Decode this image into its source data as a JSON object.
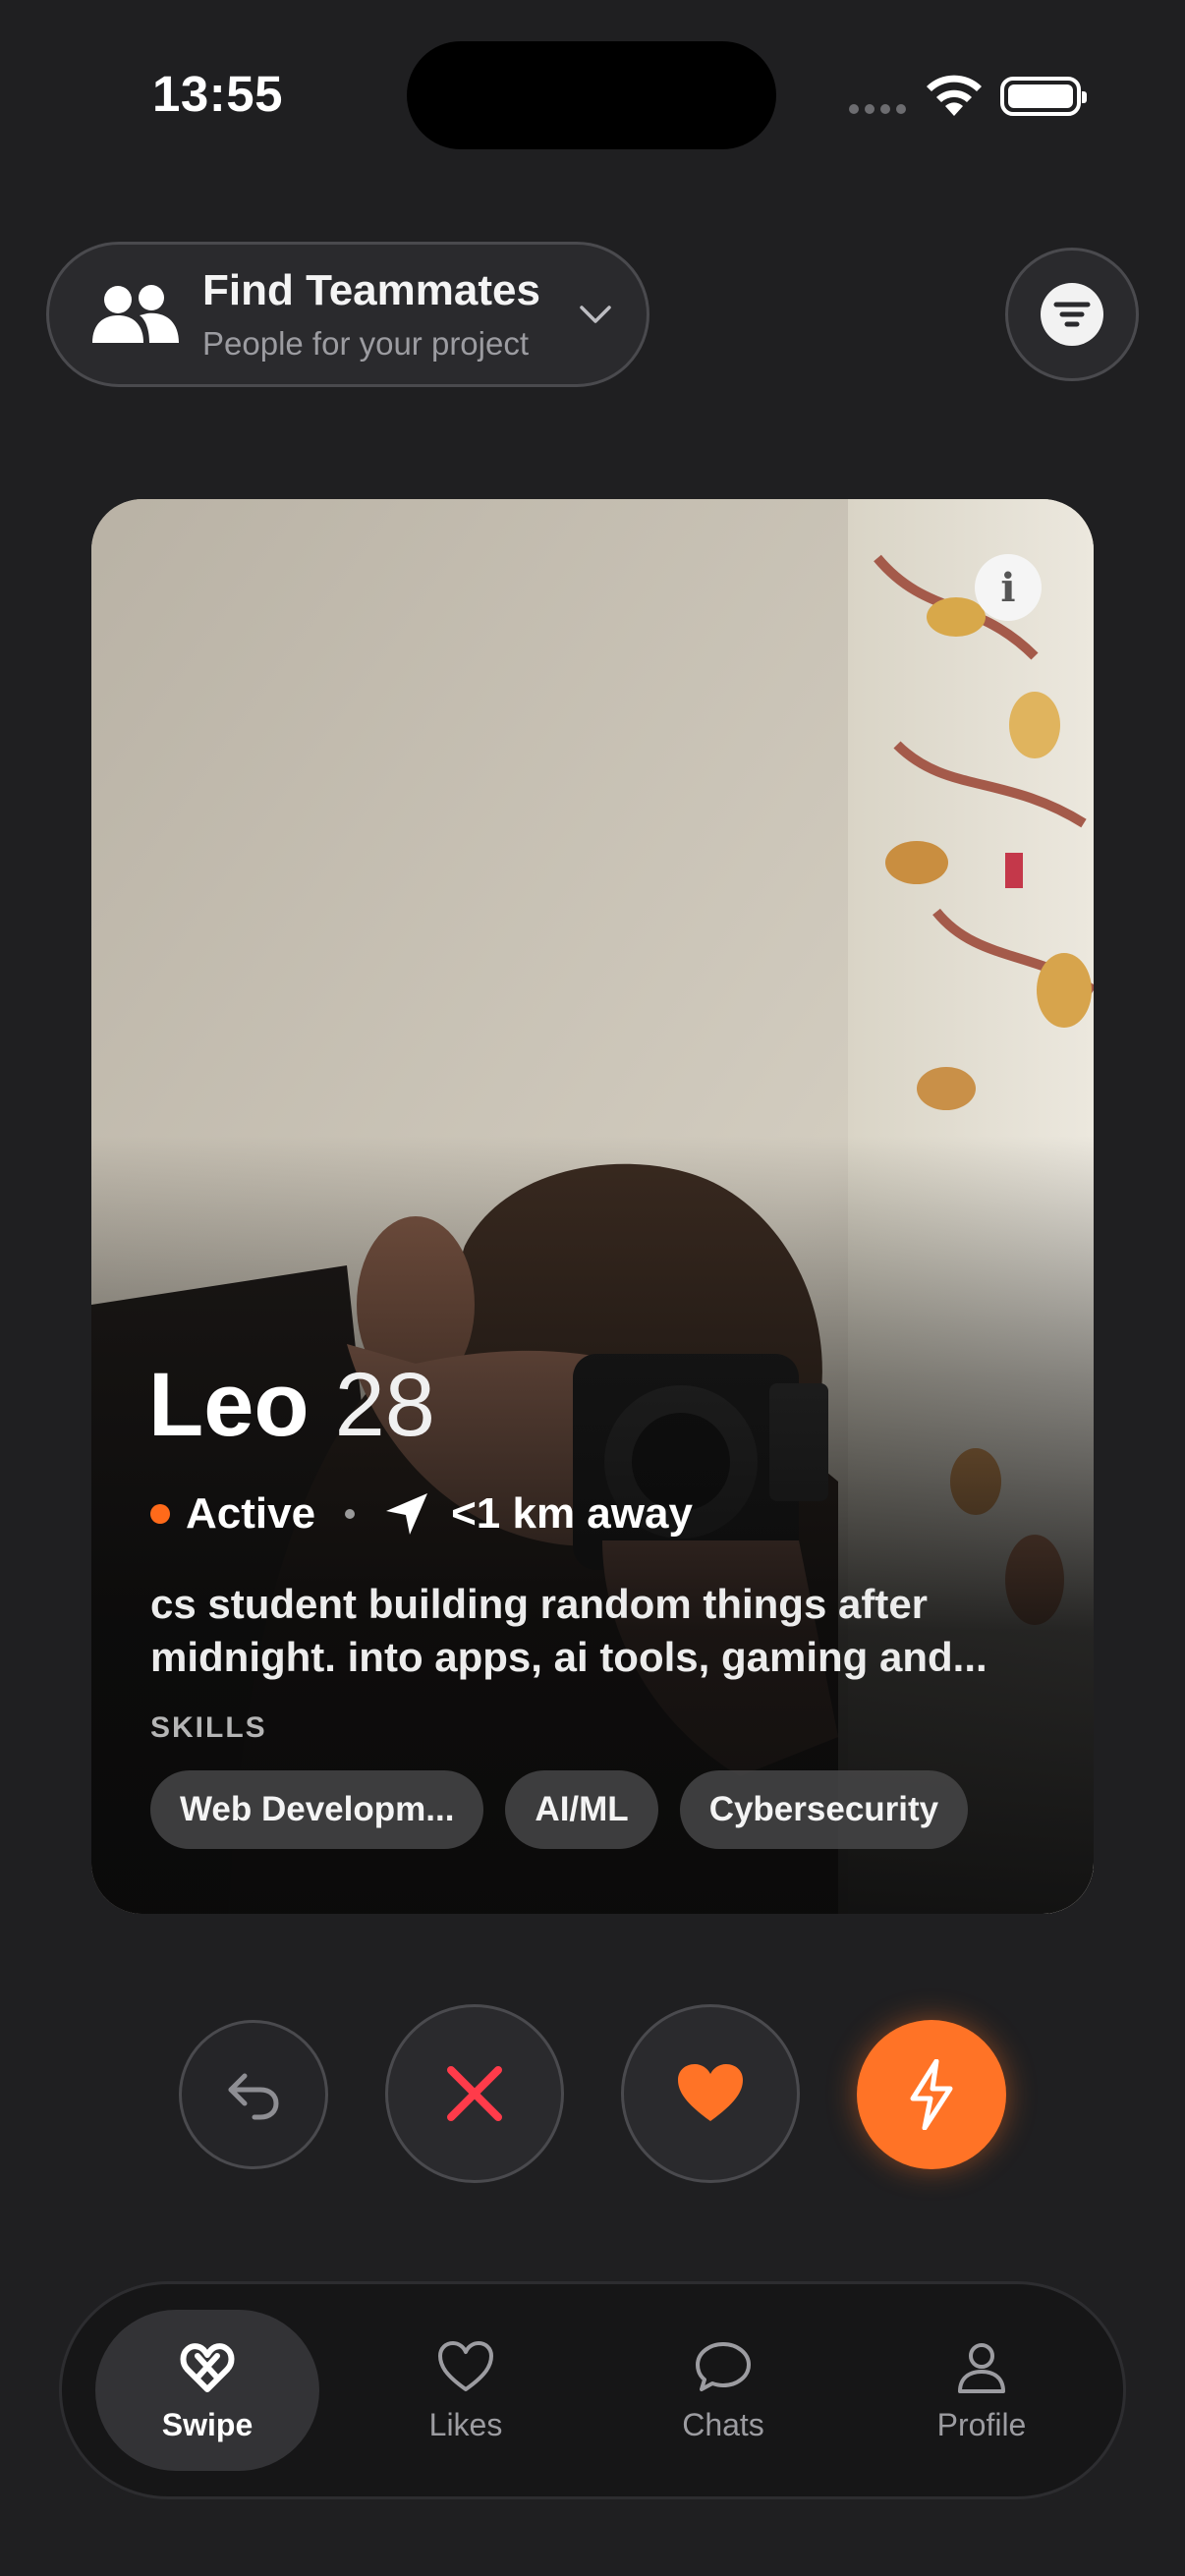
{
  "status_bar": {
    "time": "13:55"
  },
  "header": {
    "mode_title": "Find Teammates",
    "mode_subtitle": "People for your project"
  },
  "profile": {
    "name": "Leo",
    "age": "28",
    "status": "Active",
    "distance": "<1 km away",
    "bio": "cs student building random things after midnight. into apps, ai tools, gaming and...",
    "skills_label": "SKILLS",
    "skills": [
      "Web Developm...",
      "AI/ML",
      "Cybersecurity"
    ]
  },
  "actions": [
    "undo-icon",
    "close-icon",
    "heart-icon",
    "bolt-icon"
  ],
  "tabbar": {
    "tabs": [
      {
        "label": "Swipe",
        "icon": "swipe-icon",
        "active": true
      },
      {
        "label": "Likes",
        "icon": "heart-outline-icon",
        "active": false
      },
      {
        "label": "Chats",
        "icon": "chat-bubble-icon",
        "active": false
      },
      {
        "label": "Profile",
        "icon": "person-icon",
        "active": false
      }
    ]
  },
  "colors": {
    "background": "#1f1f21",
    "accent": "#ff7326",
    "reject": "#ff3b4a",
    "active_dot": "#ff6a1a"
  }
}
